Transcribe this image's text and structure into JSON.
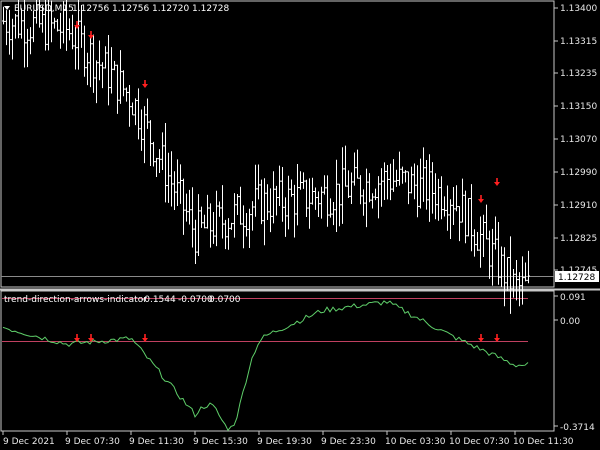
{
  "main_chart": {
    "symbol_label": "EURUSD,M15",
    "ohlc": [
      "1.12756",
      "1.12756",
      "1.12720",
      "1.12728"
    ],
    "price_axis": [
      "1.13400",
      "1.13315",
      "1.13235",
      "1.13150",
      "1.13070",
      "1.12990",
      "1.12910",
      "1.12825",
      "1.12745"
    ],
    "current_price_tag": "1.12728"
  },
  "indicator": {
    "title": "trend-direction-arrows-indicator",
    "values": [
      "-0.1544",
      "-0.0700",
      "0.0700"
    ],
    "axis": [
      "0.091",
      "0.00",
      "-0.3714"
    ]
  },
  "time_axis": [
    "9 Dec 2021",
    "9 Dec 07:30",
    "9 Dec 11:30",
    "9 Dec 15:30",
    "9 Dec 19:30",
    "9 Dec 23:30",
    "10 Dec 03:30",
    "10 Dec 07:30",
    "10 Dec 11:30"
  ],
  "colors": {
    "background": "#000000",
    "bar": "#ffffff",
    "arrow": "#ff2020",
    "osc_line": "#5fcf6a",
    "level_line": "#c04060",
    "border": "#c8c8c8",
    "text": "#ffffff"
  },
  "icons": {
    "symbol_marker": "triangle-down-icon",
    "signal": "arrow-down-icon"
  },
  "chart_data": [
    {
      "type": "line",
      "name": "EURUSD M15 price path",
      "x": [
        "9 Dec 2021",
        "9 Dec 07:30",
        "9 Dec 11:30",
        "9 Dec 15:30",
        "9 Dec 19:30",
        "9 Dec 23:30",
        "10 Dec 03:30",
        "10 Dec 07:30",
        "10 Dec 11:30"
      ],
      "y": [
        1.1336,
        1.1334,
        1.1318,
        1.1286,
        1.1293,
        1.1295,
        1.1299,
        1.1295,
        1.1273
      ],
      "ylim": [
        1.1274,
        1.134
      ]
    },
    {
      "type": "line",
      "name": "trend-direction-arrows-indicator",
      "x": [
        "9 Dec 2021",
        "9 Dec 07:30",
        "9 Dec 11:30",
        "9 Dec 15:30",
        "9 Dec 19:30",
        "9 Dec 23:30",
        "10 Dec 03:30",
        "10 Dec 07:30",
        "10 Dec 11:30"
      ],
      "y": [
        -0.02,
        -0.08,
        -0.06,
        -0.33,
        -0.06,
        0.04,
        0.07,
        -0.05,
        -0.1544
      ],
      "levels": [
        0.07,
        -0.07
      ],
      "ylim": [
        -0.3714,
        0.091
      ]
    }
  ]
}
